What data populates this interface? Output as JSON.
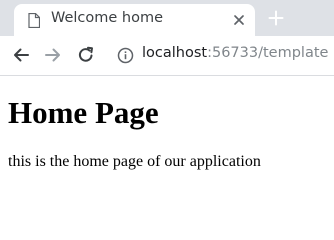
{
  "tab": {
    "title": "Welcome home",
    "favicon_icon": "document-icon",
    "close_icon": "close-icon"
  },
  "new_tab_icon": "plus-icon",
  "toolbar": {
    "back_icon": "arrow-left-icon",
    "forward_icon": "arrow-right-icon",
    "reload_icon": "reload-icon",
    "site_info_icon": "info-icon",
    "url_host": "localhost",
    "url_rest": ":56733/template"
  },
  "page": {
    "heading": "Home Page",
    "text": "this is the home page of our application"
  },
  "colors": {
    "tabstrip_bg": "#dee1e6",
    "tab_bg": "#ffffff",
    "url_host": "#202124",
    "url_rest": "#80868b"
  }
}
